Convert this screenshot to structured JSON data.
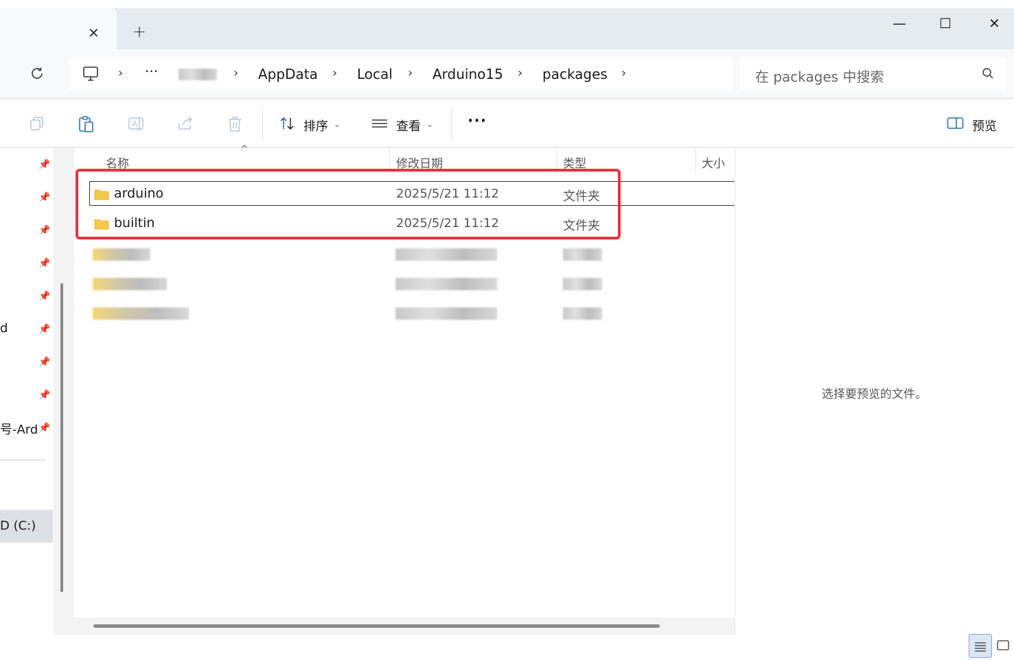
{
  "window": {
    "tab_close": "✕",
    "new_tab": "+",
    "minimize": "—",
    "maximize": "☐",
    "close": "✕"
  },
  "address": {
    "ellipsis": "···",
    "crumbs": [
      "AppData",
      "Local",
      "Arduino15",
      "packages"
    ],
    "search_placeholder": "在 packages 中搜索"
  },
  "toolbar": {
    "sort_label": "排序",
    "view_label": "查看",
    "more_label": "···",
    "preview_label": "预览"
  },
  "sidebar": {
    "partial_item_1": "d",
    "partial_item_2": "号-Ard",
    "drive_label": "D (C:)"
  },
  "columns": {
    "name": "名称",
    "modified": "修改日期",
    "type": "类型",
    "size": "大小"
  },
  "files": [
    {
      "name": "arduino",
      "modified": "2025/5/21 11:12",
      "type": "文件夹"
    },
    {
      "name": "builtin",
      "modified": "2025/5/21 11:12",
      "type": "文件夹"
    }
  ],
  "preview_message": "选择要预览的文件。",
  "colors": {
    "highlight_box": "#e8323a",
    "folder_yellow": "#f7c948"
  }
}
